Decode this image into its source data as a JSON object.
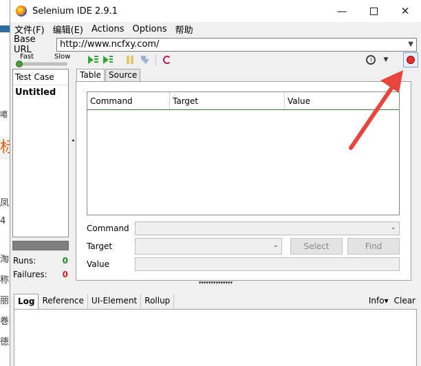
{
  "window": {
    "title": "Selenium IDE 2.9.1",
    "controls": {
      "minimize": "—",
      "maximize": "",
      "close": "✕"
    }
  },
  "menu": [
    "文件(F)",
    "编辑(E)",
    "Actions",
    "Options",
    "帮助"
  ],
  "base_url": {
    "label": "Base URL",
    "value": "http://www.ncfxy.com/"
  },
  "toolbar": {
    "speed": {
      "fast_label": "Fast",
      "slow_label": "Slow",
      "level": 0
    }
  },
  "test_case_panel": {
    "header": "Test Case",
    "items": [
      "Untitled"
    ]
  },
  "stats": {
    "runs_label": "Runs:",
    "runs_value": "0",
    "failures_label": "Failures:",
    "failures_value": "0"
  },
  "editor": {
    "tabs": [
      "Table",
      "Source"
    ],
    "columns": [
      "Command",
      "Target",
      "Value"
    ],
    "command_label": "Command",
    "target_label": "Target",
    "value_label": "Value",
    "select_button": "Select",
    "find_button": "Find"
  },
  "log": {
    "tabs": [
      "Log",
      "Reference",
      "UI-Element",
      "Rollup"
    ],
    "info_label": "Info▾",
    "clear_label": "Clear"
  },
  "background_fragments": [
    "噶",
    "标",
    "凤",
    "4",
    "淘",
    "称",
    "丽",
    "巻",
    "徳"
  ],
  "colors": {
    "record": "#e03030",
    "play": "#2fa82f",
    "annotation_arrow": "#e8453c",
    "runs": "#1f8a1f",
    "failures": "#d42020"
  }
}
